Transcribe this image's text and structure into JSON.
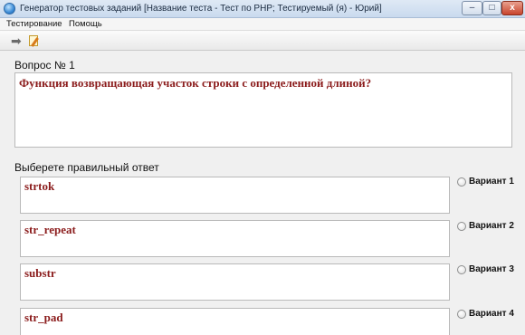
{
  "window": {
    "title": "Генератор тестовых заданий [Название теста - Тест по PHP; Тестируемый (я) - Юрий]",
    "minimize_glyph": "–",
    "maximize_glyph": "□",
    "close_glyph": "x"
  },
  "menu": {
    "items": [
      "Тестирование",
      "Помощь"
    ]
  },
  "toolbar": {
    "tools": [
      "arrow-right-icon",
      "edit-document-icon"
    ]
  },
  "question": {
    "label": "Вопрос № 1",
    "text": "Функция возвращающая участок строки с определенной длиной?"
  },
  "answers": {
    "label": "Выберете правильный ответ",
    "options": [
      {
        "text": "strtok",
        "variant": "Вариант 1",
        "selected": false
      },
      {
        "text": "str_repeat",
        "variant": "Вариант 2",
        "selected": false
      },
      {
        "text": "substr",
        "variant": "Вариант 3",
        "selected": false
      },
      {
        "text": "str_pad",
        "variant": "Вариант 4",
        "selected": false
      }
    ]
  },
  "colors": {
    "question_text": "#8b1c1c",
    "titlebar": "#c9daee"
  }
}
